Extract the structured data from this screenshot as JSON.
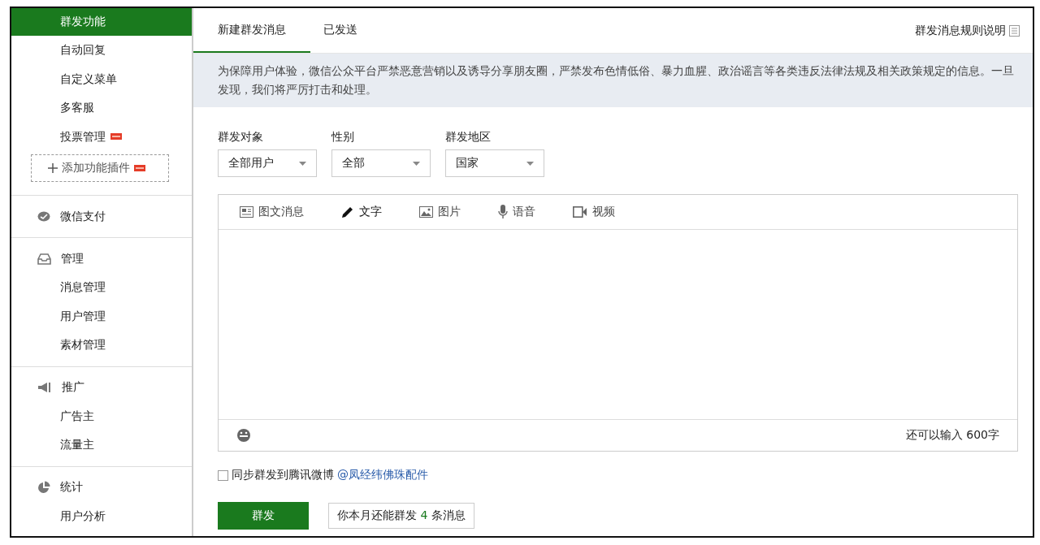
{
  "sidebar": {
    "items": [
      {
        "label": "群发功能",
        "selected": true,
        "new": false
      },
      {
        "label": "自动回复",
        "selected": false,
        "new": false
      },
      {
        "label": "自定义菜单",
        "selected": false,
        "new": false
      },
      {
        "label": "多客服",
        "selected": false,
        "new": false
      },
      {
        "label": "投票管理",
        "selected": false,
        "new": true
      }
    ],
    "add_plugin": {
      "label": "添加功能插件",
      "new": true
    },
    "sections": [
      {
        "title": "微信支付"
      },
      {
        "title": "管理",
        "items": [
          {
            "label": "消息管理"
          },
          {
            "label": "用户管理"
          },
          {
            "label": "素材管理"
          }
        ]
      },
      {
        "title": "推广",
        "items": [
          {
            "label": "广告主"
          },
          {
            "label": "流量主"
          }
        ]
      },
      {
        "title": "统计",
        "items": [
          {
            "label": "用户分析"
          }
        ]
      }
    ]
  },
  "tabs": [
    {
      "label": "新建群发消息",
      "selected": true
    },
    {
      "label": "已发送",
      "selected": false
    }
  ],
  "rules_link": "群发消息规则说明",
  "notice": "为保障用户体验，微信公众平台严禁恶意营销以及诱导分享朋友圈，严禁发布色情低俗、暴力血腥、政治谣言等各类违反法律法规及相关政策规定的信息。一旦发现，我们将严厉打击和处理。",
  "filters": [
    {
      "label": "群发对象",
      "value": "全部用户"
    },
    {
      "label": "性别",
      "value": "全部"
    },
    {
      "label": "群发地区",
      "value": "国家"
    }
  ],
  "composer": {
    "types": [
      {
        "label": "图文消息",
        "selected": false
      },
      {
        "label": "文字",
        "selected": true
      },
      {
        "label": "图片",
        "selected": false
      },
      {
        "label": "语音",
        "selected": false
      },
      {
        "label": "视频",
        "selected": false
      }
    ],
    "counter": "还可以输入 600字"
  },
  "sync": {
    "label": "同步群发到腾讯微博",
    "link": "@凤经纬佛珠配件",
    "checked": false
  },
  "send_button": "群发",
  "quota": {
    "before": "你本月还能群发",
    "count": "4",
    "after": "条消息"
  }
}
